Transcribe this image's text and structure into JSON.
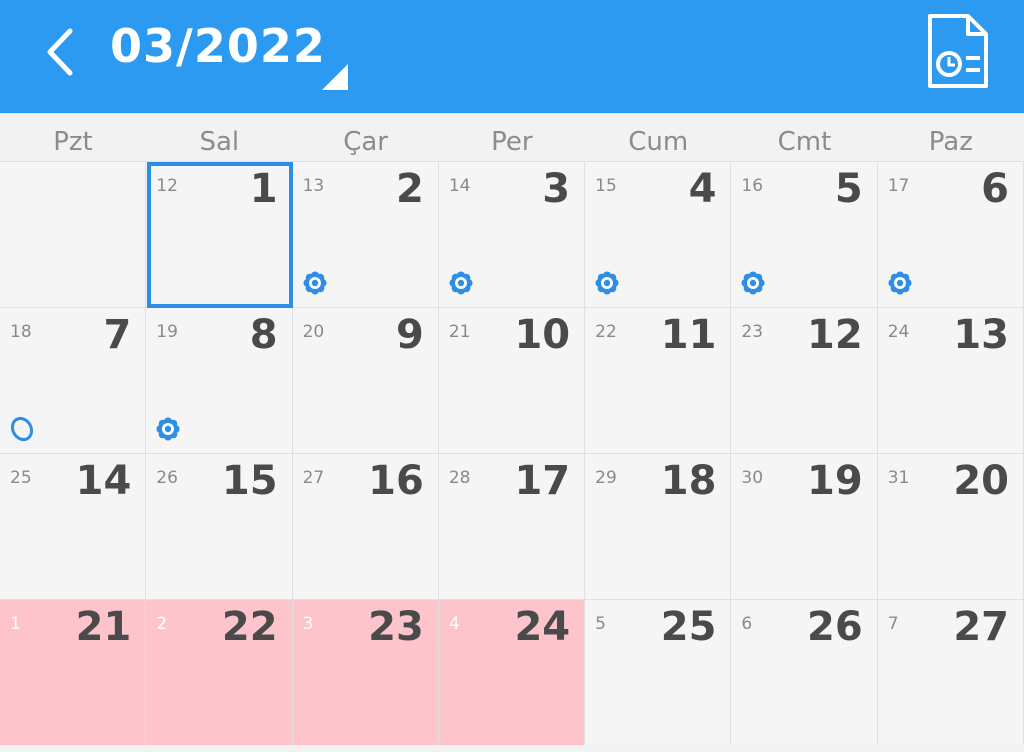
{
  "header": {
    "month_label": "03/2022",
    "back_icon": "chevron-left-icon",
    "report_icon": "document-clock-icon",
    "colors": {
      "bar": "#2b9af0",
      "text": "#ffffff"
    }
  },
  "weekdays": [
    "Pzt",
    "Sal",
    "Çar",
    "Per",
    "Cum",
    "Cmt",
    "Paz"
  ],
  "selected_day": "1",
  "colors": {
    "period": "#fdc4cc",
    "selection": "#2d8ee6",
    "marker": "#2d8ee6"
  },
  "rows": [
    [
      {
        "day": "",
        "lunar": "",
        "marker": "",
        "period": false
      },
      {
        "day": "1",
        "lunar": "12",
        "marker": "",
        "period": false
      },
      {
        "day": "2",
        "lunar": "13",
        "marker": "flower",
        "period": false
      },
      {
        "day": "3",
        "lunar": "14",
        "marker": "flower",
        "period": false
      },
      {
        "day": "4",
        "lunar": "15",
        "marker": "flower",
        "period": false
      },
      {
        "day": "5",
        "lunar": "16",
        "marker": "flower",
        "period": false
      },
      {
        "day": "6",
        "lunar": "17",
        "marker": "flower",
        "period": false
      }
    ],
    [
      {
        "day": "7",
        "lunar": "18",
        "marker": "egg",
        "period": false
      },
      {
        "day": "8",
        "lunar": "19",
        "marker": "flower",
        "period": false
      },
      {
        "day": "9",
        "lunar": "20",
        "marker": "",
        "period": false
      },
      {
        "day": "10",
        "lunar": "21",
        "marker": "",
        "period": false
      },
      {
        "day": "11",
        "lunar": "22",
        "marker": "",
        "period": false
      },
      {
        "day": "12",
        "lunar": "23",
        "marker": "",
        "period": false
      },
      {
        "day": "13",
        "lunar": "24",
        "marker": "",
        "period": false
      }
    ],
    [
      {
        "day": "14",
        "lunar": "25",
        "marker": "",
        "period": false
      },
      {
        "day": "15",
        "lunar": "26",
        "marker": "",
        "period": false
      },
      {
        "day": "16",
        "lunar": "27",
        "marker": "",
        "period": false
      },
      {
        "day": "17",
        "lunar": "28",
        "marker": "",
        "period": false
      },
      {
        "day": "18",
        "lunar": "29",
        "marker": "",
        "period": false
      },
      {
        "day": "19",
        "lunar": "30",
        "marker": "",
        "period": false
      },
      {
        "day": "20",
        "lunar": "31",
        "marker": "",
        "period": false
      }
    ],
    [
      {
        "day": "21",
        "lunar": "1",
        "marker": "",
        "period": true
      },
      {
        "day": "22",
        "lunar": "2",
        "marker": "",
        "period": true
      },
      {
        "day": "23",
        "lunar": "3",
        "marker": "",
        "period": true
      },
      {
        "day": "24",
        "lunar": "4",
        "marker": "",
        "period": true
      },
      {
        "day": "25",
        "lunar": "5",
        "marker": "",
        "period": false
      },
      {
        "day": "26",
        "lunar": "6",
        "marker": "",
        "period": false
      },
      {
        "day": "27",
        "lunar": "7",
        "marker": "",
        "period": false
      }
    ]
  ]
}
